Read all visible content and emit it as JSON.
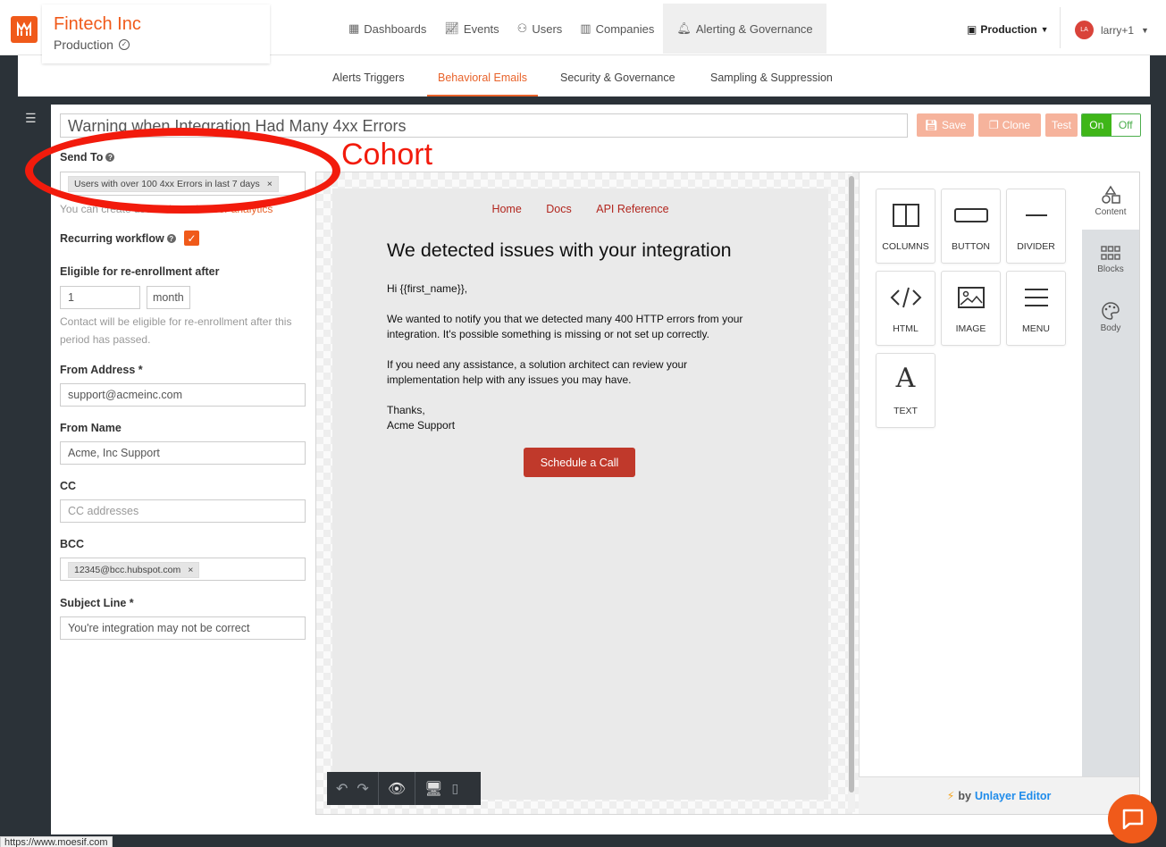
{
  "brand": {
    "name": "Fintech Inc",
    "environment": "Production"
  },
  "nav": {
    "items": [
      {
        "label": "Dashboards",
        "icon": "dashboard-icon"
      },
      {
        "label": "Events",
        "icon": "chart-icon"
      },
      {
        "label": "Users",
        "icon": "users-icon"
      },
      {
        "label": "Companies",
        "icon": "building-icon"
      },
      {
        "label": "Alerting & Governance",
        "icon": "bell-icon",
        "active": true
      }
    ],
    "env_select": "Production",
    "user": {
      "initials": "LA",
      "name": "larry+1"
    }
  },
  "subnav": {
    "tabs": [
      {
        "label": "Alerts Triggers"
      },
      {
        "label": "Behavioral Emails",
        "active": true
      },
      {
        "label": "Security & Governance"
      },
      {
        "label": "Sampling & Suppression"
      }
    ]
  },
  "workflow": {
    "title": "Warning when Integration Had Many 4xx Errors",
    "buttons": {
      "save": "Save",
      "clone": "Clone",
      "test": "Test",
      "on": "On",
      "off": "Off"
    }
  },
  "form": {
    "send_to_label": "Send To",
    "send_to_chip": "Users with over 100 4xx Errors in last 7 days",
    "send_to_hint": "You can create user cohorts in",
    "send_to_hint_link": "user analytics",
    "recurring_label": "Recurring workflow",
    "reenroll_label": "Eligible for re-enrollment after",
    "reenroll_value": "1",
    "reenroll_unit": "month",
    "reenroll_hint": "Contact will be eligible for re-enrollment after this period has passed.",
    "from_address_label": "From Address *",
    "from_address_value": "support@acmeinc.com",
    "from_name_label": "From Name",
    "from_name_value": "Acme, Inc Support",
    "cc_label": "CC",
    "cc_placeholder": "CC addresses",
    "bcc_label": "BCC",
    "bcc_chip": "12345@bcc.hubspot.com",
    "subject_label": "Subject Line *",
    "subject_value": "You're integration may not be correct"
  },
  "annotation": {
    "text": "Cohort",
    "color": "#f21b0c"
  },
  "email": {
    "nav": [
      "Home",
      "Docs",
      "API Reference"
    ],
    "heading": "We detected issues with your integration",
    "greeting": "Hi {{first_name}},",
    "p1": "We wanted to notify you that we detected many 400 HTTP errors from your integration. It's possible something is missing or not set up correctly.",
    "p2": "If you need any assistance, a solution architect can review your implementation help with any issues you may have.",
    "sign1": "Thanks,",
    "sign2": "Acme Support",
    "cta": "Schedule a Call"
  },
  "tools": {
    "tiles": [
      "COLUMNS",
      "BUTTON",
      "DIVIDER",
      "HTML",
      "IMAGE",
      "MENU",
      "TEXT"
    ],
    "tabs": [
      "Content",
      "Blocks",
      "Body"
    ],
    "footer_by": "by",
    "footer_brand": "Unlayer Editor"
  },
  "status_url": "https://www.moesif.com",
  "colors": {
    "accent": "#f05a1a",
    "link": "#e8632b",
    "email_link": "#b2261e",
    "on_green": "#3fb618"
  }
}
